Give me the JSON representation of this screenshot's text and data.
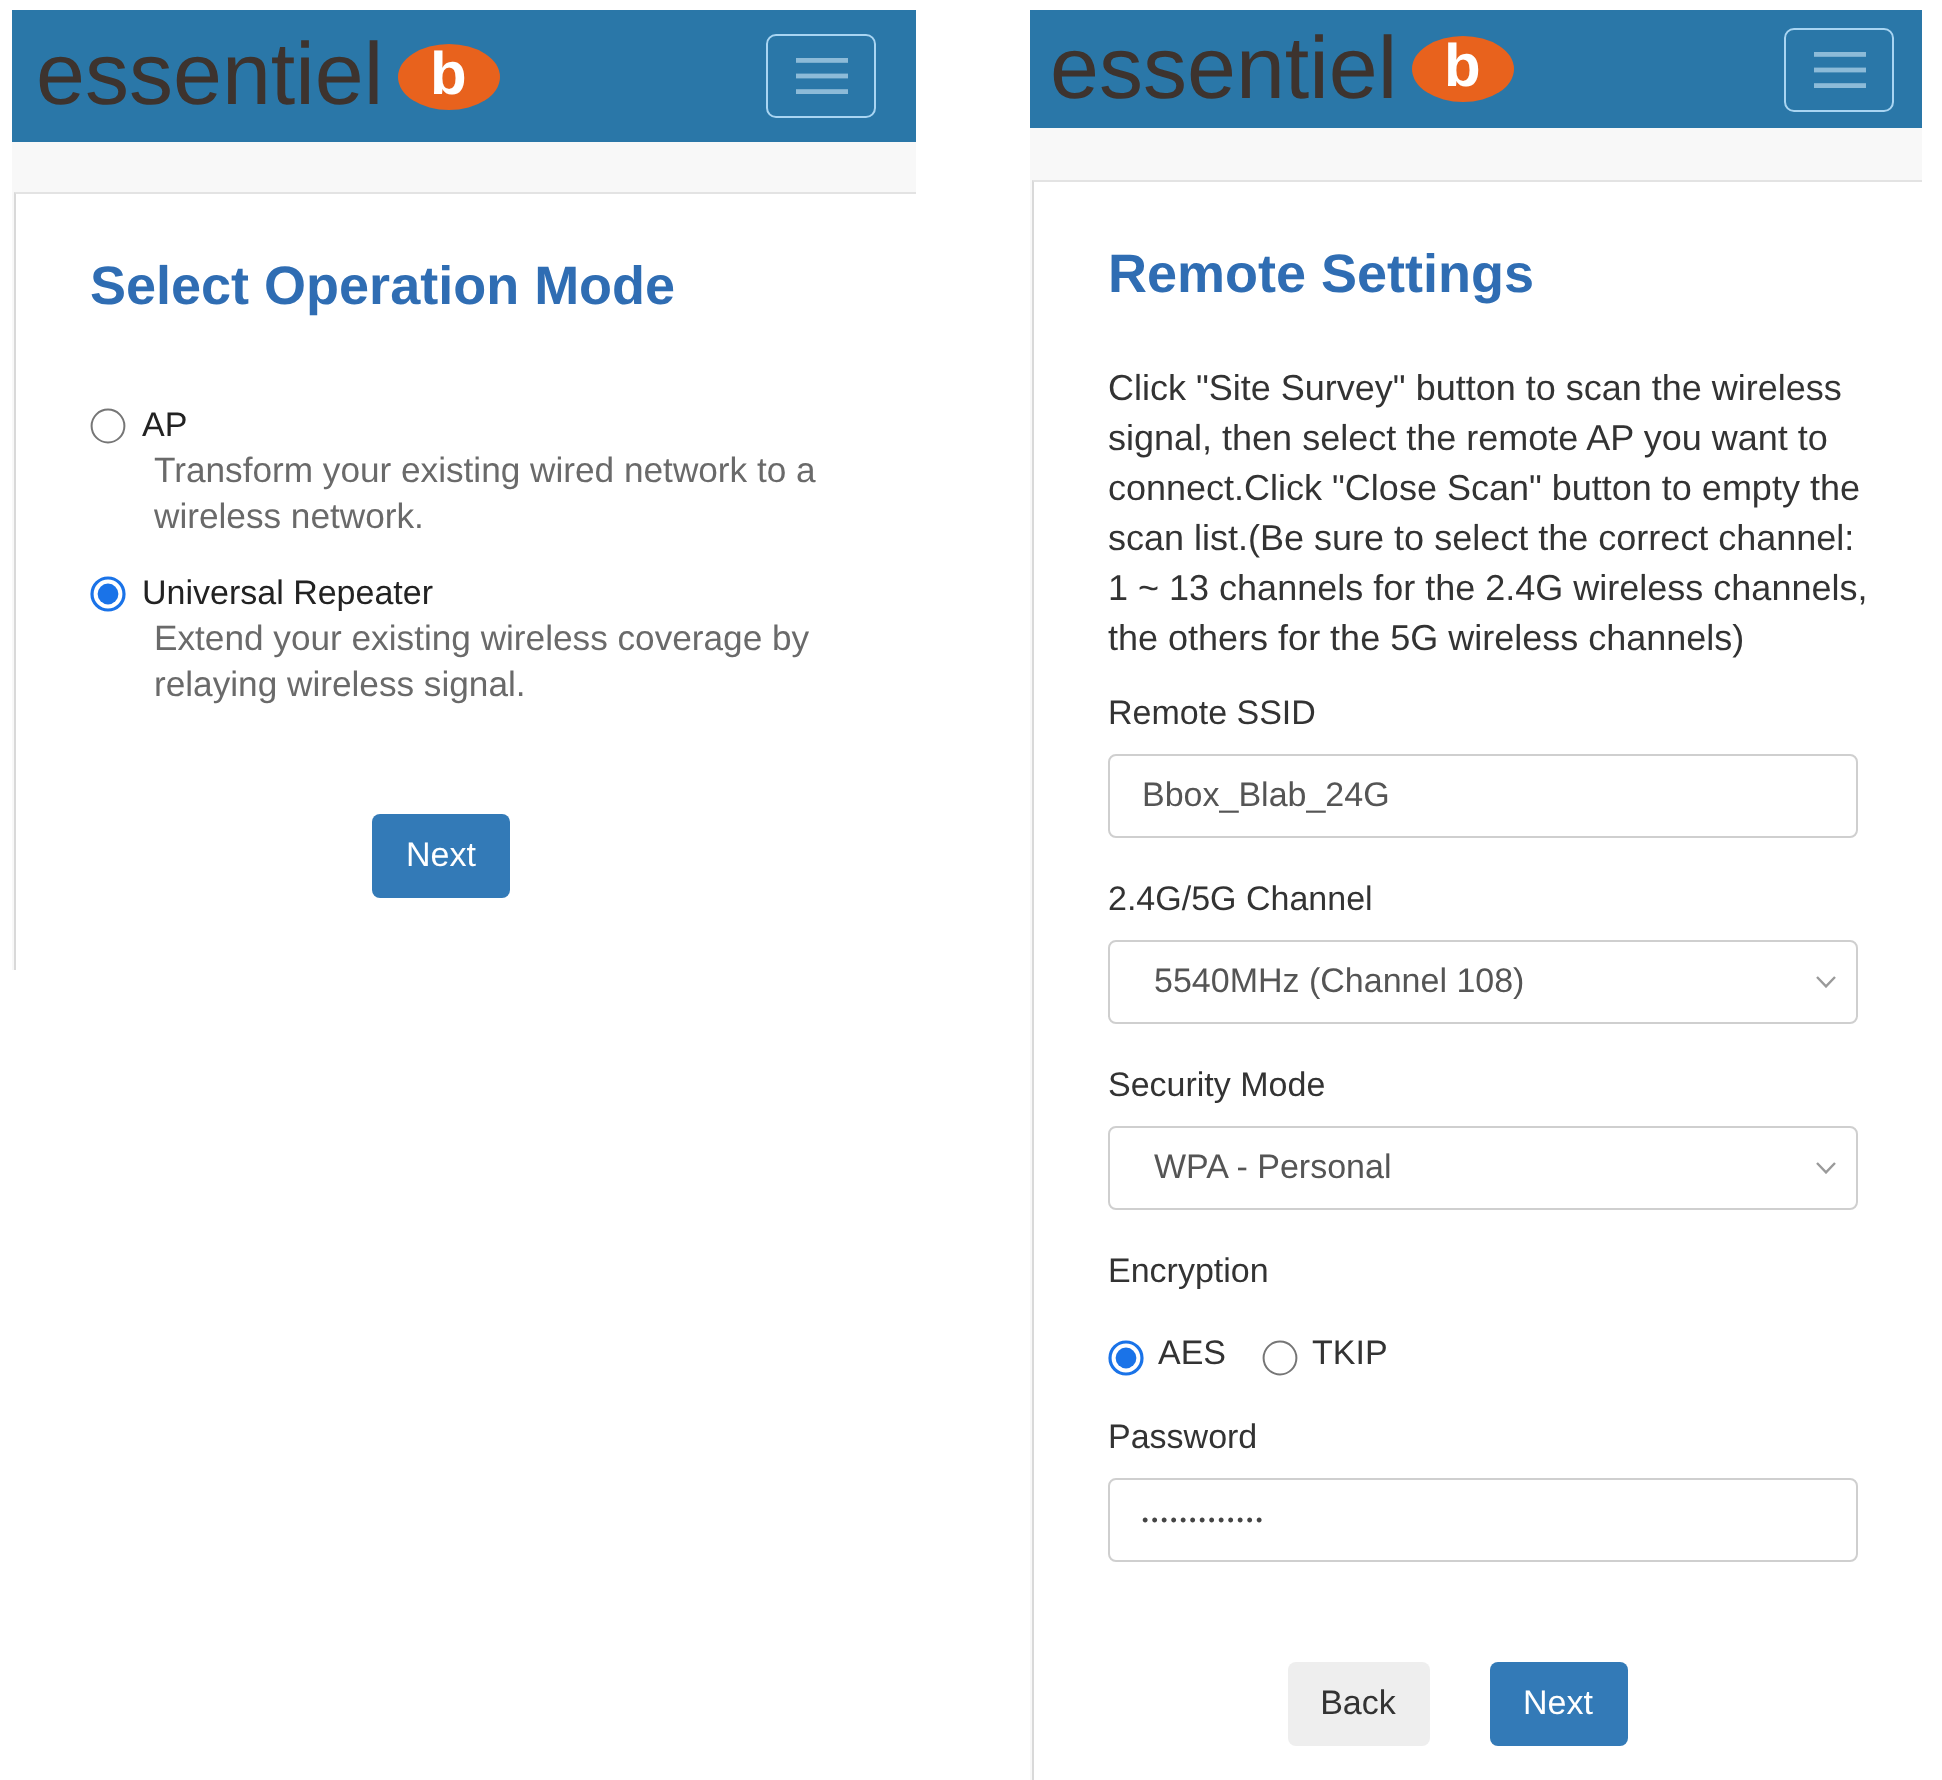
{
  "operation_mode_screen": {
    "header": {
      "logo_text": "essentiel",
      "logo_mark": "b"
    },
    "title": "Select Operation Mode",
    "modes": [
      {
        "label": "AP",
        "description": "Transform your existing wired network to a wireless network.",
        "selected": false
      },
      {
        "label": "Universal Repeater",
        "description": "Extend your existing wireless coverage by relaying wireless signal.",
        "selected": true
      }
    ],
    "buttons": [
      {
        "label": "Next",
        "kind": "primary"
      }
    ]
  },
  "remote_settings_screen": {
    "header": {
      "logo_text": "essentiel",
      "logo_mark": "b"
    },
    "title": "Remote Settings",
    "instructions": "Click \"Site Survey\" button to scan the wireless signal, then select the remote AP you want to connect.Click \"Close Scan\" button to empty the scan list.(Be sure to select the correct channel: 1 ~ 13 channels for the 2.4G wireless channels, the others for the 5G wireless channels)",
    "fields": [
      {
        "kind": "text",
        "label": "Remote SSID",
        "value": "Bbox_Blab_24G"
      },
      {
        "kind": "select",
        "label": "2.4G/5G Channel",
        "value": "5540MHz (Channel 108)"
      },
      {
        "kind": "select",
        "label": "Security Mode",
        "value": "WPA - Personal"
      },
      {
        "kind": "radio",
        "label": "Encryption",
        "options": [
          {
            "label": "AES",
            "selected": true
          },
          {
            "label": "TKIP",
            "selected": false
          }
        ]
      },
      {
        "kind": "password",
        "label": "Password",
        "value": "•••••••••••••"
      }
    ],
    "buttons": [
      {
        "label": "Back",
        "kind": "secondary"
      },
      {
        "label": "Next",
        "kind": "primary"
      }
    ]
  }
}
